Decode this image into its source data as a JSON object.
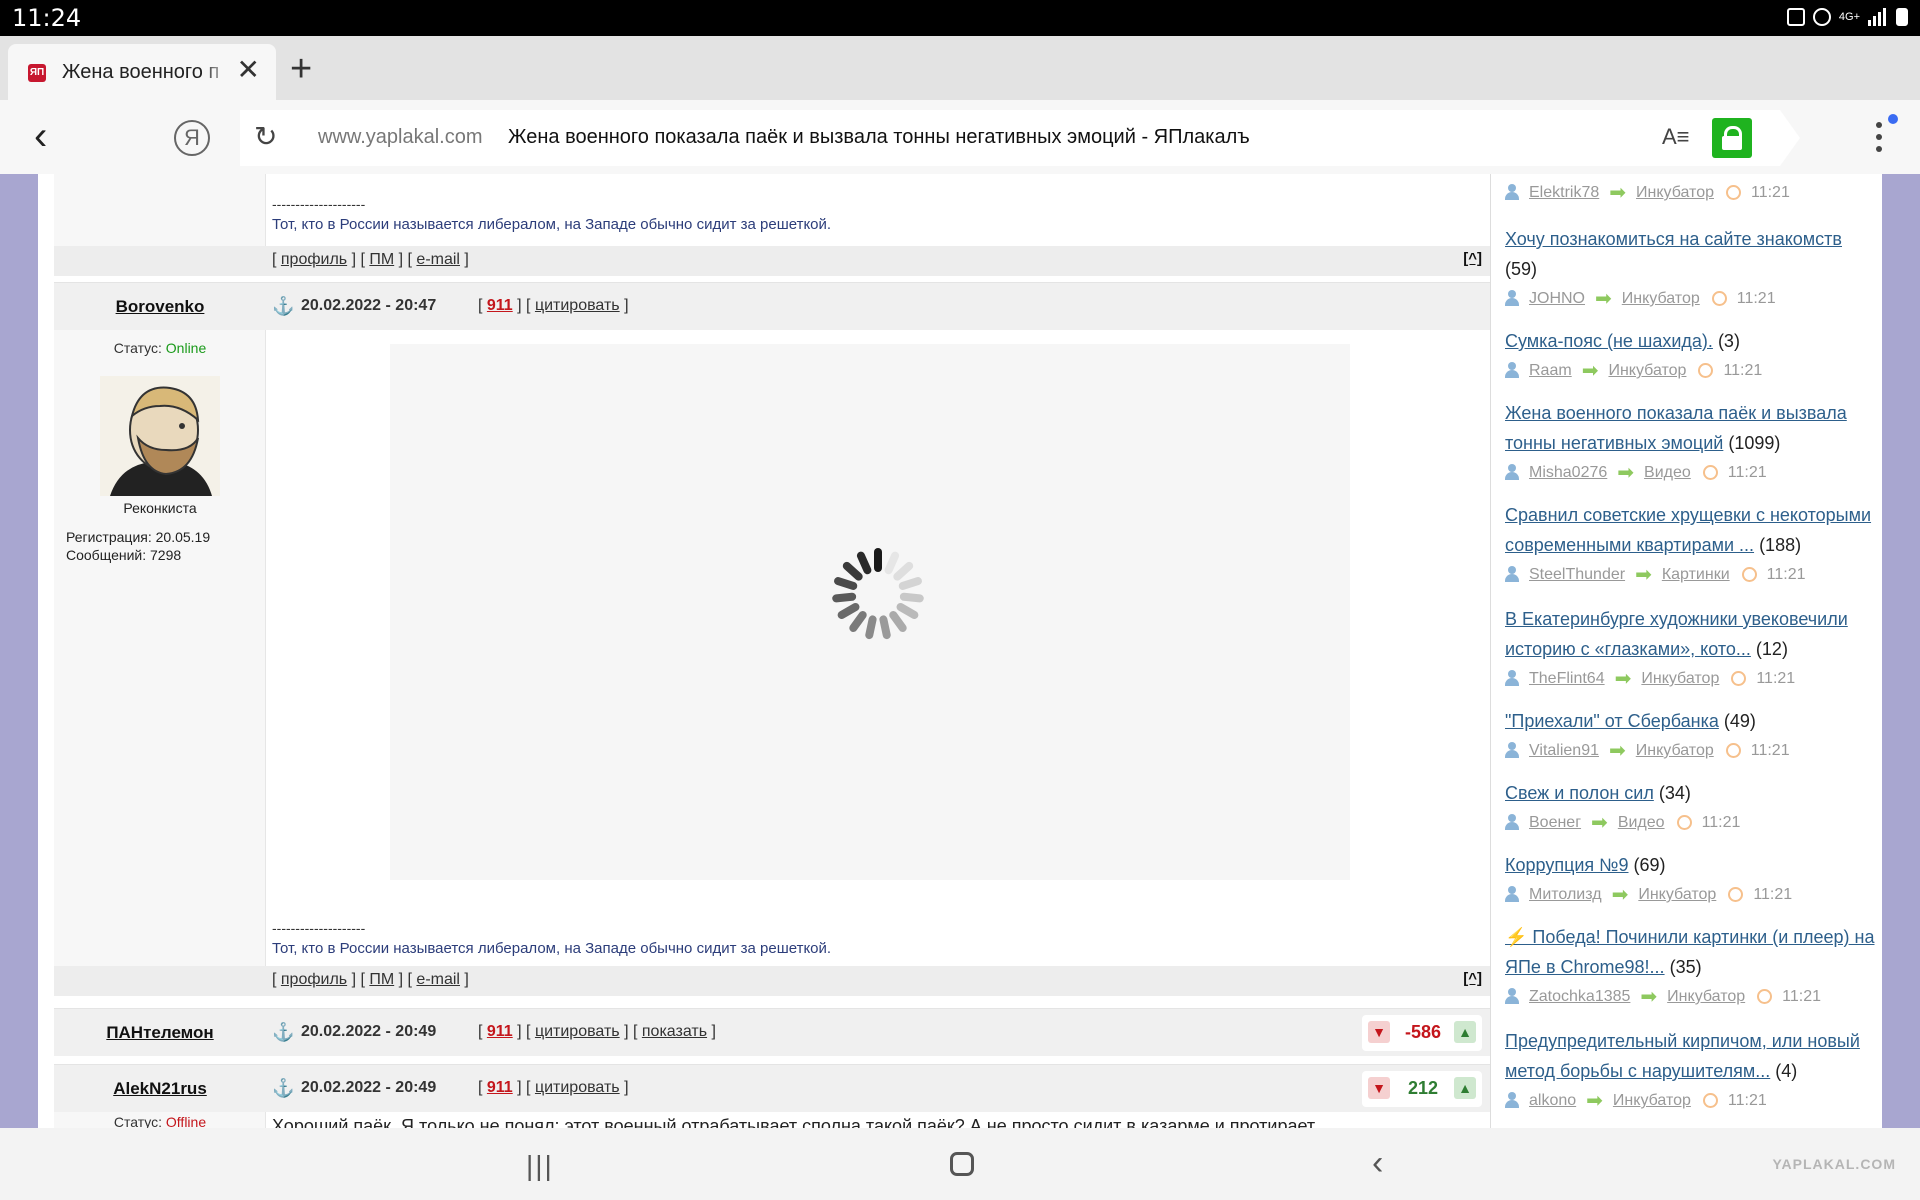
{
  "status_bar": {
    "time": "11:24",
    "network": "4G+"
  },
  "browser": {
    "tab_title": "Жена военного п",
    "favicon_text": "ЯП",
    "url_domain": "www.yaplakal.com",
    "page_title": "Жена военного показала паёк и вызвала тонны негативных эмоций - ЯПлакалъ",
    "reader_icon": "A≡",
    "new_tab": "+",
    "close": "✕",
    "ya": "Я",
    "accent": "#1fb31f"
  },
  "forum": {
    "sig_dashes": "--------------------",
    "signature": "Тот, кто в России называется либералом, на Западе обычно сидит за решеткой.",
    "post_links": {
      "profile": "профиль",
      "pm": "ПМ",
      "email": "e-mail",
      "up": "[^]"
    },
    "header_links": {
      "n911": "911",
      "quote": "цитировать",
      "show": "показать"
    },
    "status_label": "Статус:",
    "posts": [
      {
        "author": "Borovenko",
        "date": "20.02.2022 - 20:47",
        "status": "Online",
        "rank": "Реконкиста",
        "registration": "Регистрация: 20.05.19",
        "messages": "Сообщений: 7298"
      },
      {
        "author": "ПАНтелемон",
        "date": "20.02.2022 - 20:49",
        "rating": "-586"
      },
      {
        "author": "AlekN21rus",
        "date": "20.02.2022 - 20:49",
        "rating": "212",
        "status": "Offline",
        "text_start": "Хороший паёк. Я только не понял: этот военный отрабатывает сполна такой паёк? А не просто сидит в казарме и протирает"
      }
    ]
  },
  "sidebar": {
    "items": [
      {
        "title": "",
        "count": "",
        "user": "Elektrik78",
        "section": "Инкубатор",
        "time": "11:21"
      },
      {
        "title": "Хочу познакомиться на сайте знакомств",
        "count": "(59)",
        "user": "JOHNO",
        "section": "Инкубатор",
        "time": "11:21"
      },
      {
        "title": "Сумка-пояс (не шахида).",
        "count": "(3)",
        "user": "Raam",
        "section": "Инкубатор",
        "time": "11:21"
      },
      {
        "title": "Жена военного показала паёк и вызвала тонны негативных эмоций",
        "count": "(1099)",
        "user": "Misha0276",
        "section": "Видео",
        "time": "11:21"
      },
      {
        "title": "Сравнил советские хрущевки с некоторыми современными квартирами ...",
        "count": "(188)",
        "user": "SteelThunder",
        "section": "Картинки",
        "time": "11:21"
      },
      {
        "title": "В Екатеринбурге художники увековечили историю с «глазками», кото...",
        "count": "(12)",
        "user": "TheFlint64",
        "section": "Инкубатор",
        "time": "11:21"
      },
      {
        "title": "\"Приехали\" от Сбербанка",
        "count": "(49)",
        "user": "Vitalien91",
        "section": "Инкубатор",
        "time": "11:21"
      },
      {
        "title": "Свеж и полон сил",
        "count": "(34)",
        "user": "Военег",
        "section": "Видео",
        "time": "11:21"
      },
      {
        "title": "Коррупция №9",
        "count": "(69)",
        "user": "Митолизд",
        "section": "Инкубатор",
        "time": "11:21"
      },
      {
        "title": "⚡ Победа! Починили картинки (и плеер) на ЯПе в Chrome98!...",
        "count": "(35)",
        "user": "Zatochka1385",
        "section": "Инкубатор",
        "time": "11:21"
      },
      {
        "title": "Предупредительный кирпичом, или новый метод борьбы с нарушителям...",
        "count": "(4)",
        "user": "alkono",
        "section": "Инкубатор",
        "time": "11:21"
      }
    ]
  },
  "navbar": {
    "recent": "|||",
    "back": "‹",
    "watermark": "YAPLAKAL.COM"
  }
}
